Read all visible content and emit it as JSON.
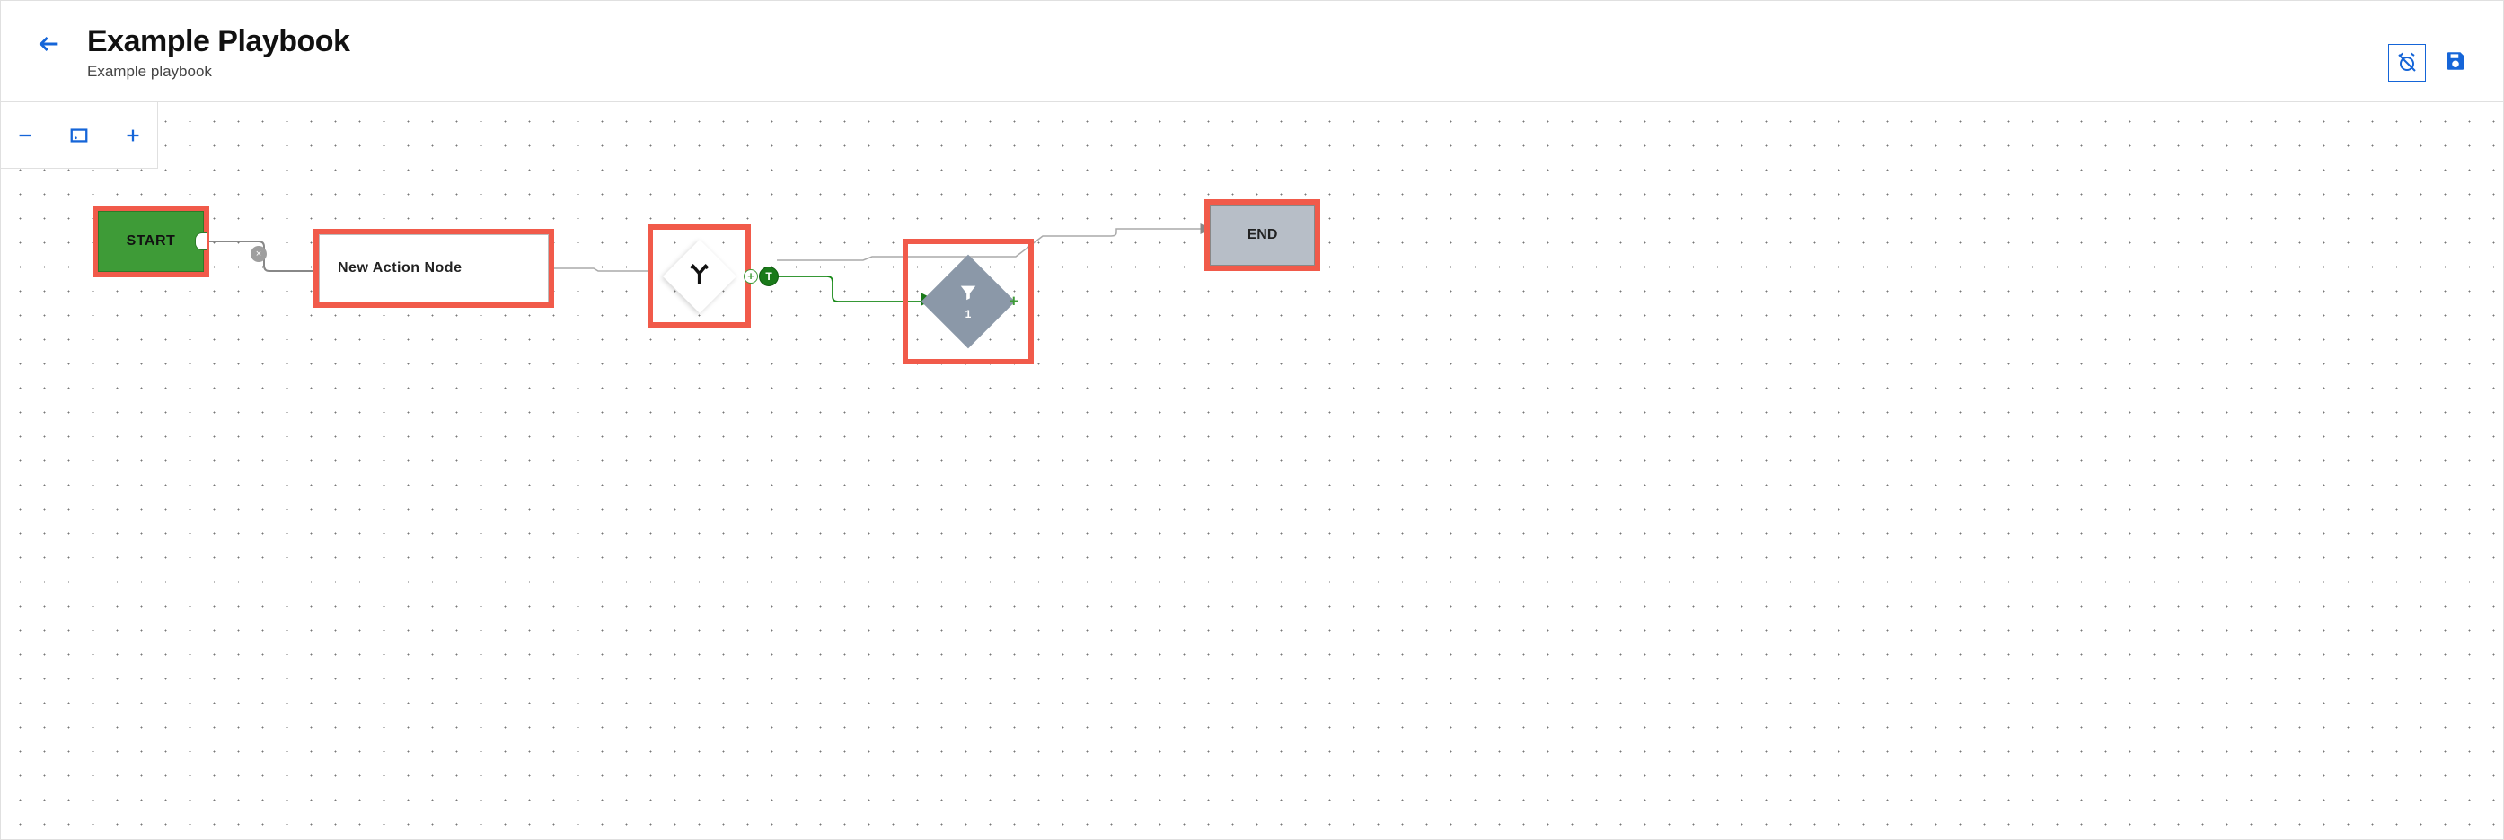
{
  "header": {
    "title": "Example Playbook",
    "subtitle": "Example playbook"
  },
  "nodes": {
    "start": {
      "label": "START"
    },
    "action": {
      "label": "New Action Node"
    },
    "end": {
      "label": "END"
    },
    "filter": {
      "count": "1"
    },
    "tbadge": {
      "label": "T"
    },
    "decision_plus": "+",
    "filter_plus": "+",
    "edge_x": "×"
  }
}
